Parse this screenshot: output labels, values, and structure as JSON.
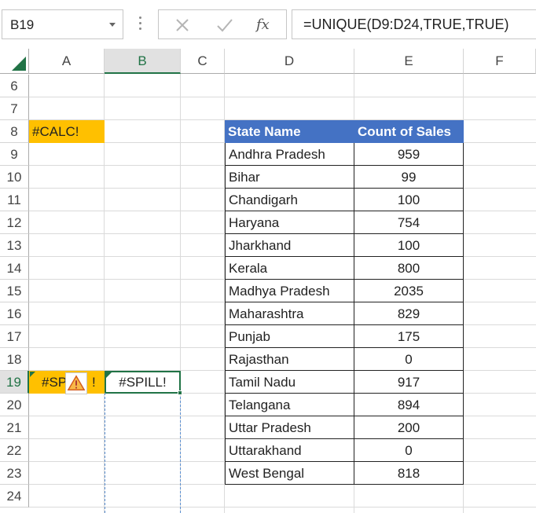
{
  "formula_bar": {
    "name_box": "B19",
    "formula": "=UNIQUE(D9:D24,TRUE,TRUE)",
    "fx_label": "fx"
  },
  "columns": [
    "A",
    "B",
    "C",
    "D",
    "E",
    "F"
  ],
  "rows": [
    "6",
    "7",
    "8",
    "9",
    "10",
    "11",
    "12",
    "13",
    "14",
    "15",
    "16",
    "17",
    "18",
    "19",
    "20",
    "21",
    "22",
    "23",
    "24"
  ],
  "cells": {
    "A8": "#CALC!",
    "A19": "#SP",
    "A19_tail": "!",
    "B19": "#SPILL!"
  },
  "table": {
    "headers": [
      "State Name",
      "Count of Sales"
    ],
    "rows": [
      [
        "Andhra Pradesh",
        "959"
      ],
      [
        "Bihar",
        "99"
      ],
      [
        "Chandigarh",
        "100"
      ],
      [
        "Haryana",
        "754"
      ],
      [
        "Jharkhand",
        "100"
      ],
      [
        "Kerala",
        "800"
      ],
      [
        "Madhya Pradesh",
        "2035"
      ],
      [
        "Maharashtra",
        "829"
      ],
      [
        "Punjab",
        "175"
      ],
      [
        "Rajasthan",
        "0"
      ],
      [
        "Tamil Nadu",
        "917"
      ],
      [
        "Telangana",
        "894"
      ],
      [
        "Uttar Pradesh",
        "200"
      ],
      [
        "Uttarakhand",
        "0"
      ],
      [
        "West Bengal",
        "818"
      ]
    ]
  },
  "colors": {
    "accent": "#217346",
    "header_fill": "#4472c4",
    "error_fill": "#ffc000"
  },
  "icons": {
    "warning": "warning-icon",
    "cancel": "cancel-icon",
    "enter": "checkmark-icon",
    "dropdown": "chevron-down-icon"
  }
}
